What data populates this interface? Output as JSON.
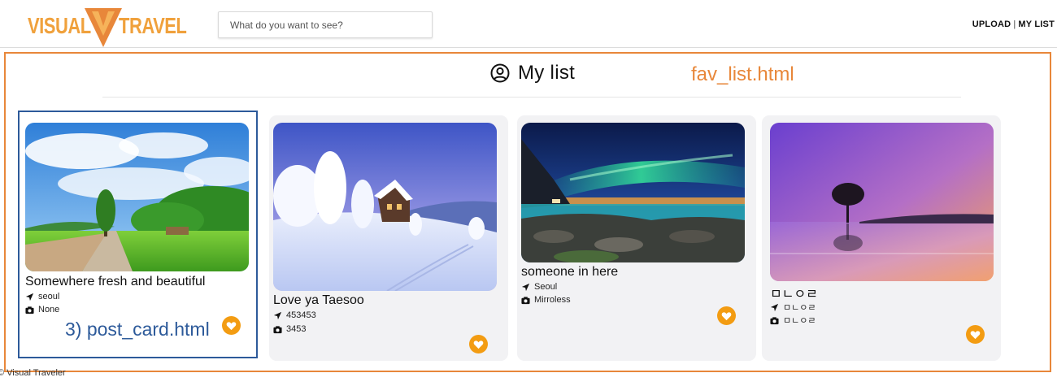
{
  "header": {
    "logo_left": "VISUAL",
    "logo_right": "TRAVEL",
    "search_placeholder": "What do you want to see?",
    "nav": {
      "upload": "UPLOAD",
      "separator": "|",
      "mylist": "MY LIST"
    }
  },
  "page": {
    "title": "My list",
    "title_icon": "user-circle-icon"
  },
  "annotations": {
    "file_label": "fav_list.html",
    "card_label": "3) post_card.html"
  },
  "colors": {
    "logo_orange": "#f0a13c",
    "annotation_orange": "#e8873a",
    "annotation_blue": "#2d5a9a",
    "heart": "#f39c12",
    "card_bg": "#f2f2f4"
  },
  "cards": [
    {
      "title": "Somewhere fresh and beautiful",
      "location": "seoul",
      "camera": "None",
      "image": "green-field-path",
      "favorited": true
    },
    {
      "title": "Love ya Taesoo",
      "location": "453453",
      "camera": "3453",
      "image": "snow-cabin",
      "favorited": true
    },
    {
      "title": "someone in here",
      "location": "Seoul",
      "camera": "Mirroless",
      "image": "aurora-rocky-shore",
      "favorited": true
    },
    {
      "title": "ㅁㄴㅇㄹ",
      "location": "ㅁㄴㅇㄹ",
      "camera": "ㅁㄴㅇㄹ",
      "image": "purple-sunset-tree",
      "favorited": true
    }
  ],
  "footer": {
    "copyright": "© Visual Traveler"
  }
}
